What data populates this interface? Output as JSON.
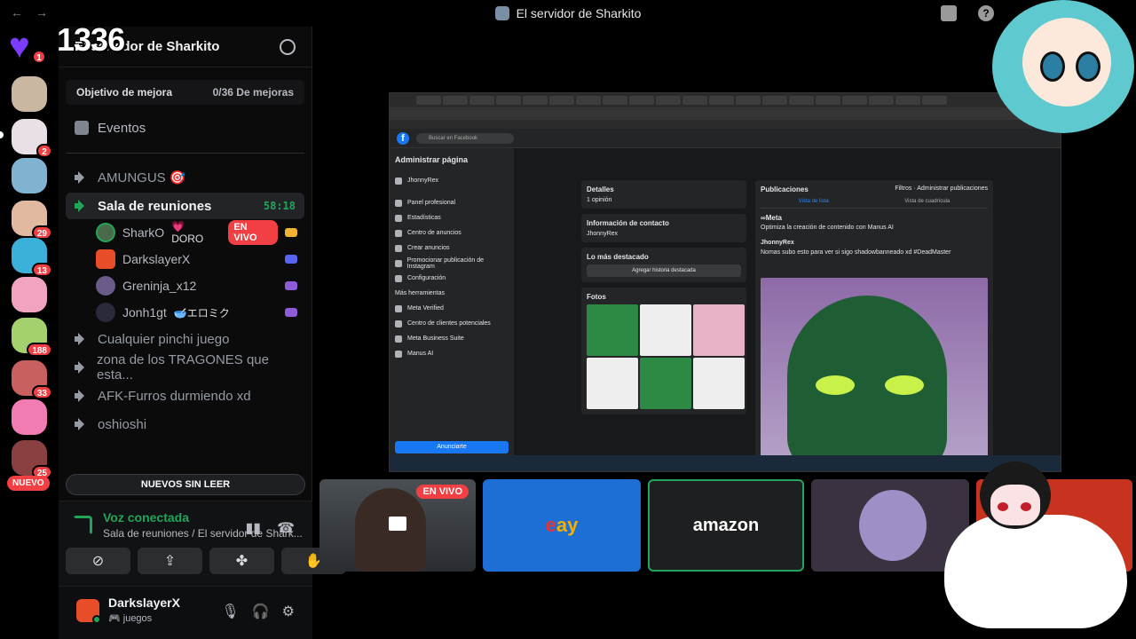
{
  "titlebar": {
    "title": "El servidor de Sharkito",
    "back": "←",
    "forward": "→",
    "help": "?"
  },
  "overlay": {
    "count": "1336",
    "heart_badge": "1"
  },
  "rail": {
    "badges": [
      "2",
      "29",
      "13",
      "188",
      "33",
      "25"
    ],
    "new_label": "NUEVO"
  },
  "server": {
    "name": "El servidor de Sharkito",
    "boost_label": "Objetivo de mejora",
    "boost_value": "0/36 De mejoras",
    "events_label": "Eventos"
  },
  "channels": {
    "amungus": "AMUNGUS 🎯",
    "active": "Sala de reuniones",
    "active_time": "58:18",
    "others": [
      "Cualquier pinchi juego",
      "zona de los TRAGONES que esta...",
      "AFK-Furros durmiendo xd",
      "oshioshi"
    ]
  },
  "members": [
    {
      "name": "SharkO",
      "tag": "💗DORO",
      "live": "EN VIVO"
    },
    {
      "name": "DarkslayerX",
      "tag": ""
    },
    {
      "name": "Greninja_x12",
      "tag": ""
    },
    {
      "name": "Jonh1gt",
      "tag": "🥣エロミク"
    }
  ],
  "new_unread": "NUEVOS SIN LEER",
  "voice": {
    "title": "Voz conectada",
    "subtitle": "Sala de reuniones / El servidor de Shark...",
    "buttons": [
      "⊘",
      "⇪",
      "✤",
      "✋"
    ]
  },
  "user": {
    "name": "DarkslayerX",
    "status": "🎮 juegos"
  },
  "facebook": {
    "search": "Buscar en Facebook",
    "page_admin": "Administrar página",
    "page_name": "JhonnyRex",
    "menu": [
      "Panel profesional",
      "Estadísticas",
      "Centro de anuncios",
      "Crear anuncios",
      "Promocionar publicación de Instagram",
      "Configuración",
      "Más herramientas",
      "Meta Verified",
      "Centro de clientes potenciales",
      "Meta Business Suite",
      "Manus AI"
    ],
    "cta": "Anunciarte",
    "details": "Detalles",
    "opinion": "1 opinión",
    "contact": "Información de contacto",
    "highlights": "Lo más destacado",
    "highlight_btn": "Agregar historia destacada",
    "photos": "Fotos",
    "publications": "Publicaciones",
    "filters": "Filtros",
    "manage": "Administrar publicaciones",
    "tab_list": "Vista de lista",
    "tab_grid": "Vista de cuadrícula",
    "meta": "∞Meta",
    "meta_text": "Optimiza la creación de contenido con Manus AI",
    "post_text": "Nomas subo esto para ver si sigo shadowbanneado xd #DeadMaster"
  },
  "thumbs": {
    "live": "EN VIVO",
    "ebay_e": "e",
    "ebay_rest": "ay",
    "amazon": "amazon"
  }
}
